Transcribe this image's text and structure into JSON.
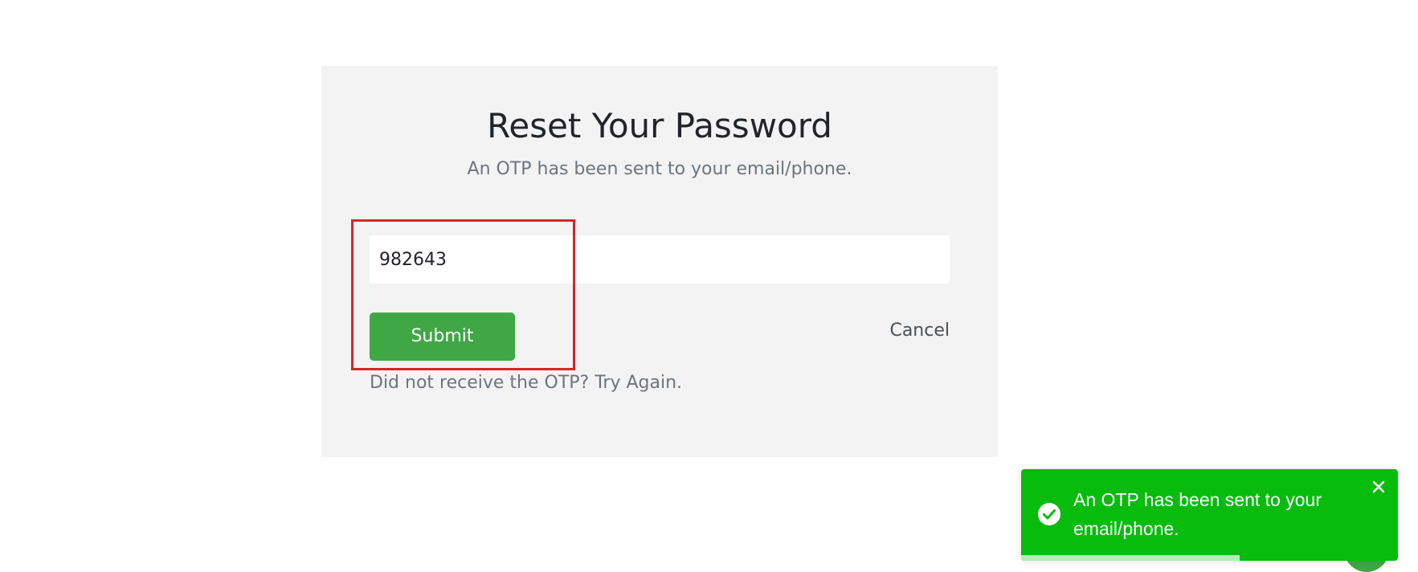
{
  "form": {
    "title": "Reset Your Password",
    "subtitle": "An OTP has been sent to your email/phone.",
    "otp_value": "982643",
    "submit_label": "Submit",
    "cancel_label": "Cancel",
    "retry_text": "Did not receive the OTP? Try Again."
  },
  "toast": {
    "message": "An OTP has been sent to your email/phone.",
    "icon": "check-circle-icon",
    "close_icon": "close-icon",
    "progress_remaining": 0.58
  },
  "colors": {
    "card_bg": "#f3f3f3",
    "submit_bg": "#3fa845",
    "toast_bg": "#07bc0c",
    "highlight": "#e0202a"
  }
}
